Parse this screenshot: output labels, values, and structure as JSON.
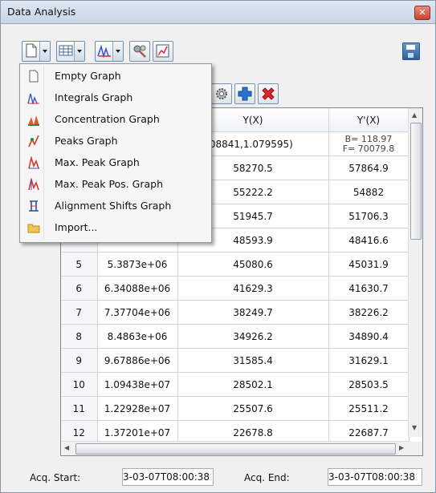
{
  "window": {
    "title": "Data Analysis",
    "close_icon": "close-icon"
  },
  "toolbar": {
    "buttons": [
      {
        "name": "new-graph-dropdown",
        "icon": "blank-page-icon"
      },
      {
        "name": "table-view-dropdown",
        "icon": "table-icon"
      },
      {
        "name": "integrals-dropdown",
        "icon": "peaks-chart-icon"
      },
      {
        "name": "settings-tool",
        "icon": "gear-tool-icon"
      },
      {
        "name": "chart-edit",
        "icon": "chart-edit-icon"
      }
    ],
    "save_icon": "floppy-disk-icon"
  },
  "menu": {
    "items": [
      {
        "label": "Empty Graph",
        "icon": "empty-page-icon"
      },
      {
        "label": "Integrals Graph",
        "icon": "integrals-icon"
      },
      {
        "label": "Concentration Graph",
        "icon": "concentration-icon"
      },
      {
        "label": "Peaks Graph",
        "icon": "peaks-icon"
      },
      {
        "label": "Max. Peak Graph",
        "icon": "max-peak-icon"
      },
      {
        "label": "Max. Peak Pos. Graph",
        "icon": "max-peak-pos-icon"
      },
      {
        "label": "Alignment Shifts Graph",
        "icon": "alignment-icon"
      },
      {
        "label": "Import...",
        "icon": "folder-icon"
      }
    ]
  },
  "table": {
    "columns": [
      "",
      "",
      "Y(X)",
      "Y'(X)"
    ],
    "header_detail": {
      "yx": "ral(1.308841,1.079595)",
      "ypx_line1": "B= 118.97",
      "ypx_line2": "F= 70079.8"
    },
    "rows": [
      {
        "idx": "",
        "x": "",
        "y": "58270.5",
        "yp": "57864.9"
      },
      {
        "idx": "",
        "x": "",
        "y": "55222.2",
        "yp": "54882"
      },
      {
        "idx": "",
        "x": "",
        "y": "51945.7",
        "yp": "51706.3"
      },
      {
        "idx": "",
        "x": "",
        "y": "48593.9",
        "yp": "48416.6"
      },
      {
        "idx": "5",
        "x": "5.3873e+06",
        "y": "45080.6",
        "yp": "45031.9"
      },
      {
        "idx": "6",
        "x": "6.34088e+06",
        "y": "41629.3",
        "yp": "41630.7"
      },
      {
        "idx": "7",
        "x": "7.37704e+06",
        "y": "38249.7",
        "yp": "38226.2"
      },
      {
        "idx": "8",
        "x": "8.4863e+06",
        "y": "34926.2",
        "yp": "34890.4"
      },
      {
        "idx": "9",
        "x": "9.67886e+06",
        "y": "31585.4",
        "yp": "31629.1"
      },
      {
        "idx": "10",
        "x": "1.09438e+07",
        "y": "28502.1",
        "yp": "28503.5"
      },
      {
        "idx": "11",
        "x": "1.22928e+07",
        "y": "25507.6",
        "yp": "25511.2"
      },
      {
        "idx": "12",
        "x": "1.37201e+07",
        "y": "22678.8",
        "yp": "22687.7"
      }
    ]
  },
  "footer": {
    "acq_start_label": "Acq. Start:",
    "acq_start_value": "3-03-07T08:00:38",
    "acq_end_label": "Acq. End:",
    "acq_end_value": "3-03-07T08:00:38"
  }
}
